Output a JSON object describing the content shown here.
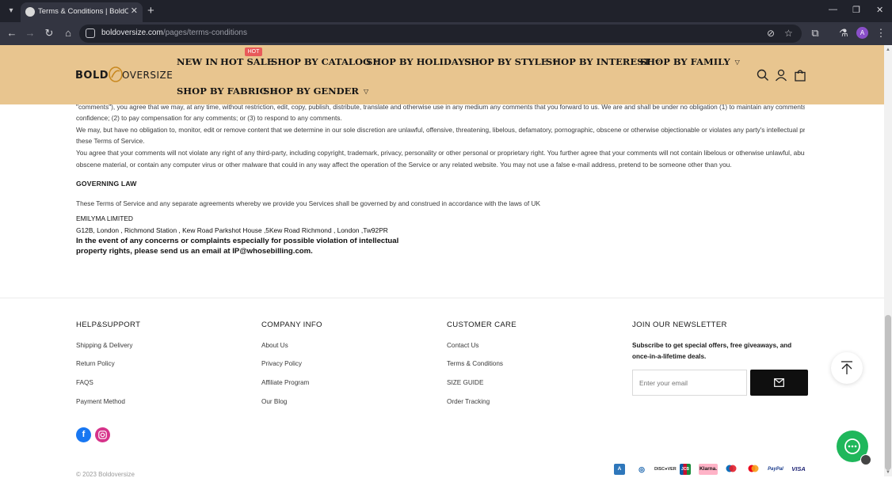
{
  "browser": {
    "tab_title": "Terms & Conditions | BoldOver",
    "url_domain": "boldoversize.com",
    "url_path": "/pages/terms-conditions",
    "profile_initial": "A"
  },
  "header": {
    "logo_left": "BOLD",
    "logo_right": "OVERSIZE",
    "hot_badge": "HOT",
    "menu_row1": [
      {
        "label": "NEW IN",
        "dropdown": false
      },
      {
        "label": "HOT SALE",
        "dropdown": false
      },
      {
        "label": "SHOP BY CATALOG",
        "dropdown": true
      },
      {
        "label": "SHOP BY HOLIDAYS",
        "dropdown": true
      },
      {
        "label": "SHOP BY STYLE",
        "dropdown": true
      },
      {
        "label": "SHOP BY INTEREST",
        "dropdown": true
      },
      {
        "label": "SHOP BY FAMILY",
        "dropdown": true
      }
    ],
    "menu_row2": [
      {
        "label": "SHOP BY FABRIC",
        "dropdown": true
      },
      {
        "label": "SHOP BY GENDER",
        "dropdown": true
      }
    ],
    "icons": [
      "search-icon",
      "account-icon",
      "cart-icon"
    ]
  },
  "content": {
    "paragraphs": [
      "\"comments\"), you agree that we may, at any time, without restriction, edit, copy, publish, distribute, translate and otherwise use in any medium any comments that you forward to us. We are and shall be under no obligation (1) to maintain any comments in",
      "confidence; (2) to pay compensation for any comments; or (3) to respond to any comments.",
      "We may, but have no obligation to, monitor, edit or remove content that we determine in our sole discretion are unlawful, offensive, threatening, libelous, defamatory, pornographic, obscene or otherwise objectionable or violates any party's intellectual property or",
      "these Terms of Service.",
      "You agree that your comments will not violate any right of any third-party, including copyright, trademark, privacy, personality or other personal or proprietary right. You further agree that your comments will not contain libelous or otherwise unlawful, abusive or",
      "obscene material, or contain any computer virus or other malware that could in any way affect the operation of the Service or any related website. You may not use a false e-mail address, pretend to be someone other than you."
    ],
    "governing_heading": "GOVERNING LAW",
    "governing_text": "These Terms of Service and any separate agreements whereby we provide you Services shall be governed by and construed in accordance with the laws of UK",
    "company_name": "EMILYMA LIMITED",
    "company_address": "G12B, London , Richmond Station , Kew Road Parkshot House ,5Kew Road Richmond , London ,Tw92PR",
    "ip_notice_line1": "In the event of any concerns or complaints especially for possible violation of intellectual",
    "ip_notice_line2": "property rights, please send us an email at IP@whosebilling.com."
  },
  "footer": {
    "columns": [
      {
        "title": "HELP&SUPPORT",
        "links": [
          "Shipping & Delivery",
          "Return Policy",
          "FAQS",
          "Payment Method"
        ]
      },
      {
        "title": "COMPANY INFO",
        "links": [
          "About Us",
          "Privacy Policy",
          "Affiliate Program",
          "Our Blog"
        ]
      },
      {
        "title": "CUSTOMER CARE",
        "links": [
          "Contact Us",
          "Terms & Conditions",
          "SIZE GUIDE",
          "Order Tracking"
        ]
      }
    ],
    "newsletter": {
      "title": "JOIN OUR NEWSLETTER",
      "description": "Subscribe to get special offers, free giveaways, and once-in-a-lifetime deals.",
      "placeholder": "Enter your email"
    },
    "social": [
      "facebook-icon",
      "instagram-icon"
    ],
    "copyright": "© 2023 Boldoversize",
    "payments": [
      "AMEX",
      "Diners",
      "DISCOVER",
      "JCB",
      "Klarna.",
      "Maestro",
      "Mastercard",
      "PayPal",
      "VISA"
    ]
  },
  "colors": {
    "header_bg": "#e8c58f",
    "chat_green": "#1fb75b",
    "browser_dark": "#20222b"
  }
}
